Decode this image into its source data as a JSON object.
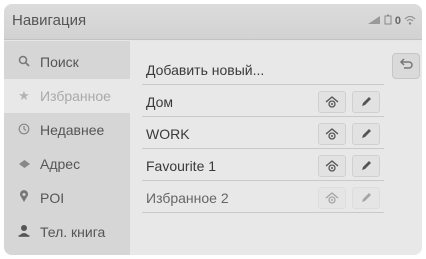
{
  "header": {
    "title": "Навигация",
    "status_number": "0"
  },
  "sidebar": {
    "items": [
      {
        "label": "Поиск",
        "icon": "search-icon"
      },
      {
        "label": "Избранное",
        "icon": "star-icon",
        "active": true
      },
      {
        "label": "Недавнее",
        "icon": "clock-icon"
      },
      {
        "label": "Адрес",
        "icon": "address-icon"
      },
      {
        "label": "POI",
        "icon": "poi-pin-icon"
      },
      {
        "label": "Тел. книга",
        "icon": "contact-icon"
      }
    ]
  },
  "main": {
    "add_new_label": "Добавить новый...",
    "favorites": [
      {
        "name": "Дом"
      },
      {
        "name": "WORK"
      },
      {
        "name": "Favourite 1"
      },
      {
        "name": "Избранное 2",
        "disabled": true
      }
    ]
  }
}
